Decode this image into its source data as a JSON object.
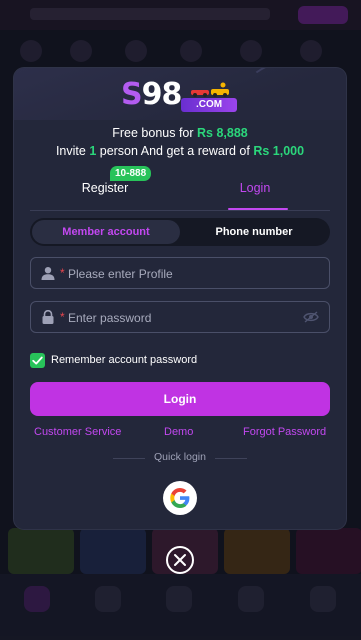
{
  "logo": {
    "brand_s": "S",
    "brand_num": "98",
    "badge": ".COM"
  },
  "bonus": {
    "line1_prefix": "Free bonus for ",
    "line1_amount": "Rs 8,888",
    "line2_prefix": "Invite ",
    "line2_count": "1",
    "line2_middle": " person And get a reward of ",
    "line2_amount": "Rs 1,000"
  },
  "tabs": {
    "register_label": "Register",
    "register_badge": "10-888",
    "login_label": "Login",
    "active": "login"
  },
  "account_type": {
    "member_label": "Member account",
    "phone_label": "Phone number",
    "selected": "member"
  },
  "form": {
    "asterisk": "*",
    "profile_placeholder": "Please enter Profile",
    "profile_value": "",
    "password_placeholder": "Enter password",
    "password_value": "",
    "remember_label": "Remember account password",
    "remember_checked": true,
    "login_button": "Login"
  },
  "links": {
    "customer_service": "Customer Service",
    "demo": "Demo",
    "forgot_password": "Forgot Password"
  },
  "quick_login": {
    "label": "Quick login",
    "provider": "google-icon"
  },
  "colors": {
    "accent": "#c033e3",
    "accent_text": "#c248f0",
    "bonus_green": "#2bd67b",
    "badge_green": "#28c35a",
    "modal_bg": "#23273a"
  },
  "icons": {
    "profile": "user-icon",
    "password": "lock-icon",
    "toggle_visibility": "eye-off-icon",
    "close": "close-icon"
  }
}
